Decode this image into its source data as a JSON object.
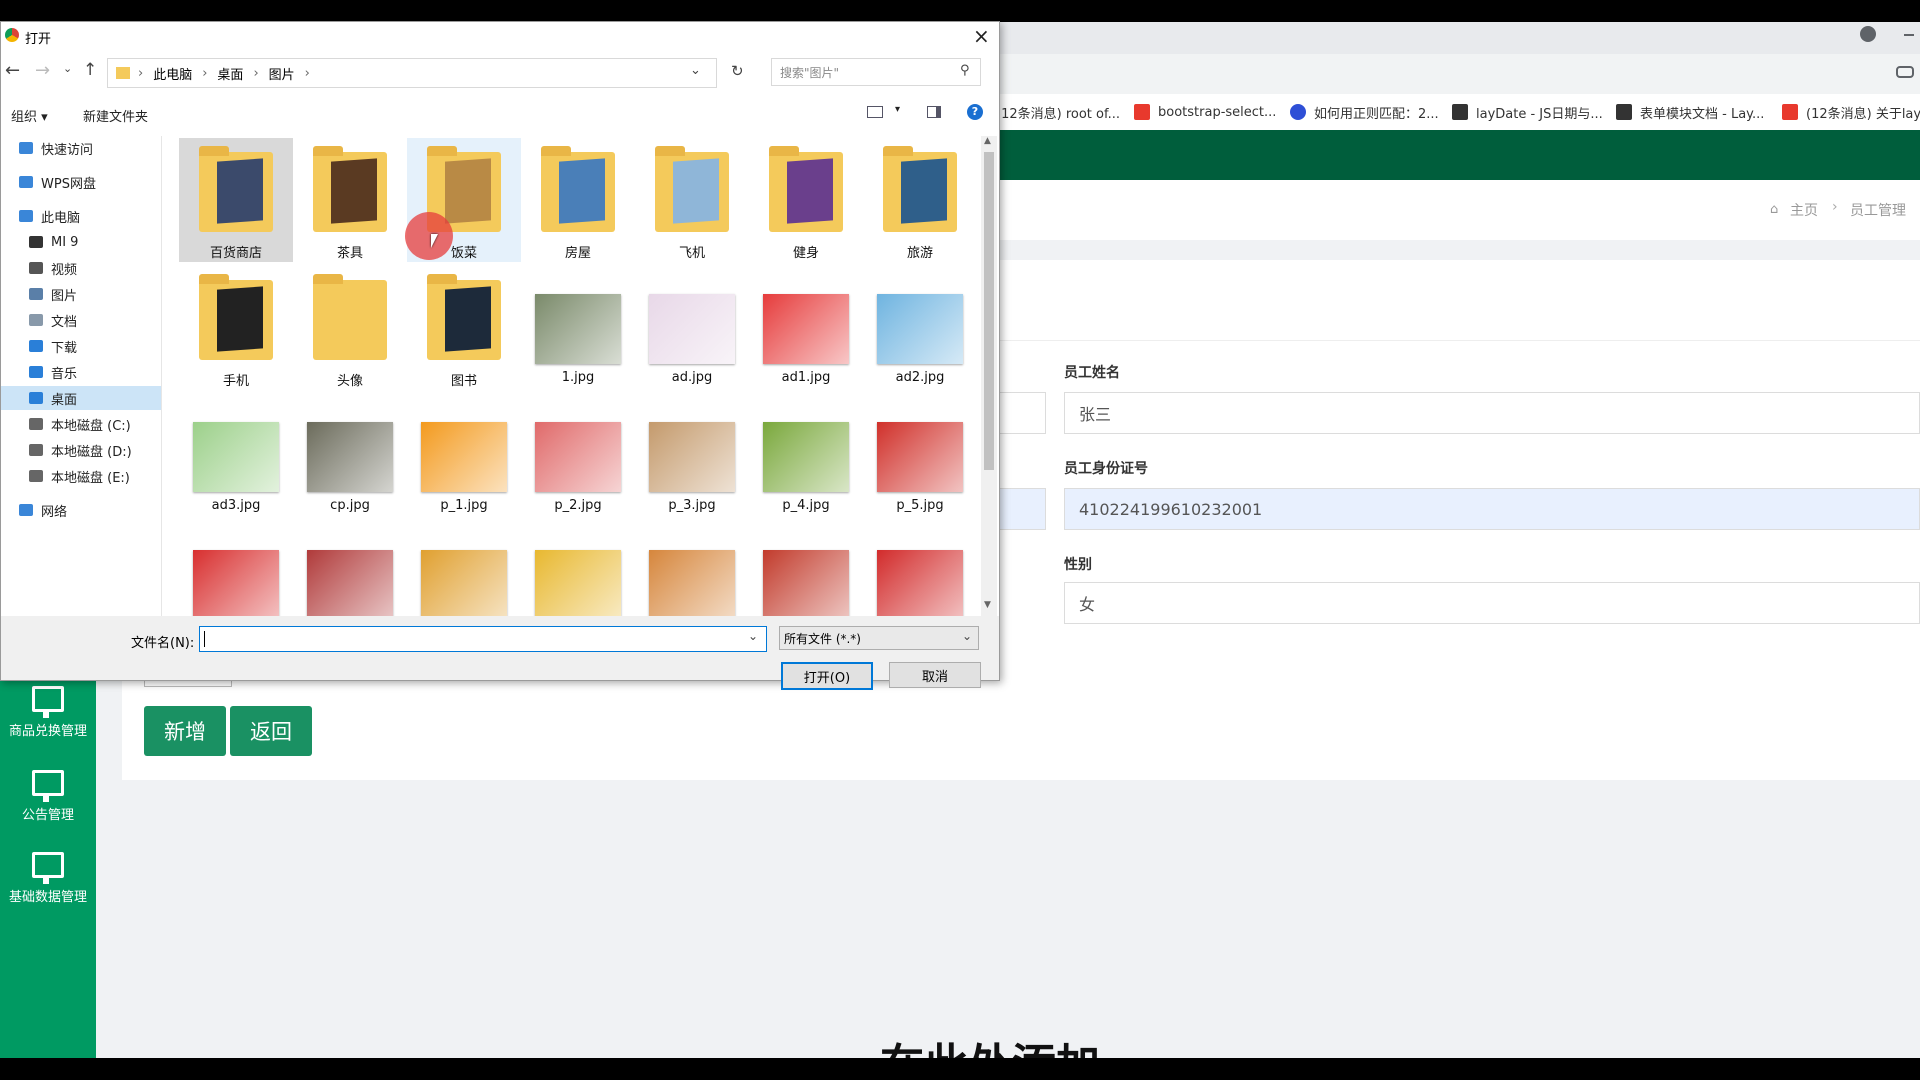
{
  "browser": {
    "bookmarks": [
      {
        "label": "(12条消息) root of...",
        "icon": "csdn-icon",
        "color": "#e8392d"
      },
      {
        "label": "bootstrap-select...",
        "icon": "web-icon",
        "color": "#e8392d"
      },
      {
        "label": "如何用正则匹配：2...",
        "icon": "baidu-paw-icon",
        "color": "#2e4fd6"
      },
      {
        "label": "layDate - JS日期与...",
        "icon": "layui-icon",
        "color": "#333333"
      },
      {
        "label": "表单模块文档 - Lay...",
        "icon": "layui-icon",
        "color": "#333333"
      },
      {
        "label": "(12条消息) 关于lay...",
        "icon": "csdn-icon",
        "color": "#e8392d"
      }
    ]
  },
  "app": {
    "breadcrumb": {
      "home": "主页",
      "current": "员工管理"
    },
    "sidebar": [
      {
        "label": "商品兑换管理"
      },
      {
        "label": "公告管理"
      },
      {
        "label": "基础数据管理"
      }
    ],
    "form": {
      "name_label": "员工姓名",
      "name_value": "张三",
      "id_label": "员工身份证号",
      "id_value": "410224199610232001",
      "gender_label": "性别",
      "gender_value": "女"
    },
    "buttons": {
      "add": "新增",
      "back": "返回"
    },
    "colors": {
      "header": "#005e3c",
      "sidebar": "#009a62",
      "button": "#1a9163"
    }
  },
  "dialog": {
    "title": "打开",
    "path": [
      "此电脑",
      "桌面",
      "图片"
    ],
    "search_placeholder": "搜索\"图片\"",
    "toolbar": {
      "organize": "组织",
      "new_folder": "新建文件夹"
    },
    "nav": [
      {
        "label": "快速访问",
        "icon": "star-icon"
      },
      {
        "label": "WPS网盘",
        "icon": "cloud-icon"
      },
      {
        "label": "此电脑",
        "icon": "computer-icon"
      },
      {
        "label": "MI 9",
        "icon": "phone-icon"
      },
      {
        "label": "视频",
        "icon": "video-icon"
      },
      {
        "label": "图片",
        "icon": "picture-icon"
      },
      {
        "label": "文档",
        "icon": "document-icon"
      },
      {
        "label": "下载",
        "icon": "download-icon"
      },
      {
        "label": "音乐",
        "icon": "music-icon"
      },
      {
        "label": "桌面",
        "icon": "desktop-icon"
      },
      {
        "label": "本地磁盘 (C:)",
        "icon": "drive-icon"
      },
      {
        "label": "本地磁盘 (D:)",
        "icon": "drive-icon"
      },
      {
        "label": "本地磁盘 (E:)",
        "icon": "drive-icon"
      },
      {
        "label": "网络",
        "icon": "network-icon"
      }
    ],
    "files": [
      {
        "name": "百货商店",
        "kind": "folder",
        "color": "#3b4a6b"
      },
      {
        "name": "茶具",
        "kind": "folder",
        "color": "#5a3a22"
      },
      {
        "name": "饭菜",
        "kind": "folder",
        "color": "#b98a45"
      },
      {
        "name": "房屋",
        "kind": "folder",
        "color": "#4a7fb8"
      },
      {
        "name": "飞机",
        "kind": "folder",
        "color": "#8fb6d8"
      },
      {
        "name": "健身",
        "kind": "folder",
        "color": "#6a3f8c"
      },
      {
        "name": "旅游",
        "kind": "folder",
        "color": "#2f5f8a"
      },
      {
        "name": "手机",
        "kind": "folder",
        "color": "#222222"
      },
      {
        "name": "头像",
        "kind": "folder",
        "color": "#f4ca5b"
      },
      {
        "name": "图书",
        "kind": "folder",
        "color": "#1d2a3a"
      },
      {
        "name": "1.jpg",
        "kind": "image",
        "color": "#7a8a6a"
      },
      {
        "name": "ad.jpg",
        "kind": "image",
        "color": "#e8d8e8"
      },
      {
        "name": "ad1.jpg",
        "kind": "image",
        "color": "#e63c3c"
      },
      {
        "name": "ad2.jpg",
        "kind": "image",
        "color": "#6fb4e0"
      },
      {
        "name": "ad3.jpg",
        "kind": "image",
        "color": "#9cd08a"
      },
      {
        "name": "cp.jpg",
        "kind": "image",
        "color": "#6b6b5b"
      },
      {
        "name": "p_1.jpg",
        "kind": "image",
        "color": "#f39a1e"
      },
      {
        "name": "p_2.jpg",
        "kind": "image",
        "color": "#e06a6a"
      },
      {
        "name": "p_3.jpg",
        "kind": "image",
        "color": "#c49a6c"
      },
      {
        "name": "p_4.jpg",
        "kind": "image",
        "color": "#7aa83c"
      },
      {
        "name": "p_5.jpg",
        "kind": "image",
        "color": "#d0302a"
      },
      {
        "name": "",
        "kind": "image",
        "color": "#d82f2f"
      },
      {
        "name": "",
        "kind": "image",
        "color": "#b03a3a"
      },
      {
        "name": "",
        "kind": "image",
        "color": "#e0a030"
      },
      {
        "name": "",
        "kind": "image",
        "color": "#e8b830"
      },
      {
        "name": "",
        "kind": "image",
        "color": "#d6863c"
      },
      {
        "name": "",
        "kind": "image",
        "color": "#c23b2c"
      },
      {
        "name": "",
        "kind": "image",
        "color": "#d22b2b"
      }
    ],
    "filename_label": "文件名(N):",
    "filename_value": "",
    "filetype": "所有文件 (*.*)",
    "open": "打开(O)",
    "cancel": "取消"
  },
  "overlay_text": "在此处添加..."
}
